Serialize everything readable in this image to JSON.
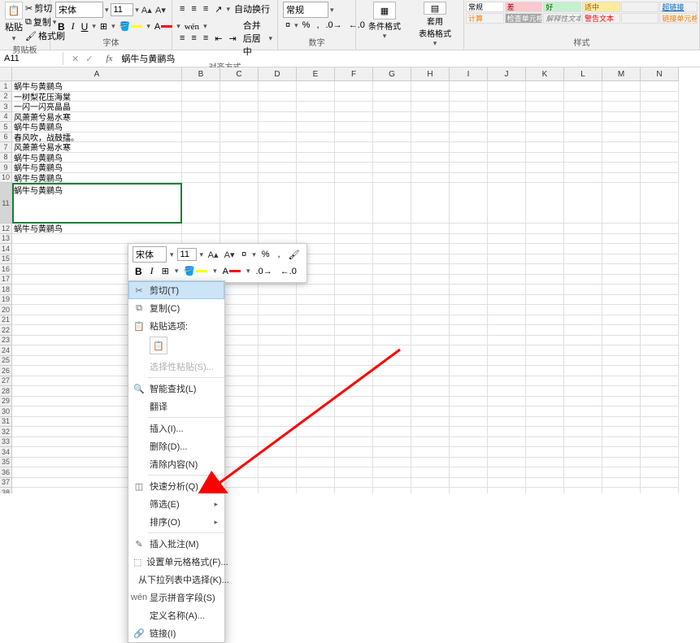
{
  "ribbon": {
    "clipboard": {
      "cut": "剪切",
      "copy": "复制",
      "format_painter": "格式刷",
      "paste": "粘贴",
      "group_label": "剪贴板"
    },
    "font": {
      "name": "宋体",
      "size": "11",
      "group_label": "字体"
    },
    "alignment": {
      "wrap": "自动换行",
      "merge": "合并后居中",
      "group_label": "对齐方式"
    },
    "number": {
      "format": "常规",
      "group_label": "数字"
    },
    "cond": {
      "cond_format": "条件格式",
      "table_format": "套用\n表格格式",
      "group_label": ""
    },
    "styles": {
      "normal": "常规",
      "bad": "差",
      "good": "好",
      "neutral": "适中",
      "hyperlink": "超链接",
      "calc": "计算",
      "check": "检查单元格",
      "explan": "解释性文本",
      "warn": "警告文本",
      "linked": "链接单元格",
      "group_label": "样式"
    }
  },
  "fb": {
    "name_box": "A11",
    "cancel": "✕",
    "confirm": "✓",
    "fx": "fx",
    "formula": "蜗牛与黄鹂鸟"
  },
  "columns": [
    "A",
    "B",
    "C",
    "D",
    "E",
    "F",
    "G",
    "H",
    "I",
    "J",
    "K",
    "L",
    "M",
    "N"
  ],
  "rows_data": [
    "蜗牛与黄鹂鸟",
    "一树梨花压海棠",
    "一闪一闪亮晶晶",
    "风萧萧兮易水寒",
    "蜗牛与黄鹂鸟",
    "春风吹，战鼓擂。",
    "风萧萧兮易水寒",
    "蜗牛与黄鹂鸟",
    "蜗牛与黄鹂鸟",
    "蜗牛与黄鹂鸟",
    "蜗牛与黄鹂鸟"
  ],
  "row_12_text": "蜗牛与黄鹂鸟",
  "mini": {
    "font": "宋体",
    "size": "11"
  },
  "ctxt": {
    "cut": "剪切(T)",
    "copy": "复制(C)",
    "paste_options": "粘贴选项:",
    "paste_special": "选择性粘贴(S)...",
    "smart_lookup": "智能查找(L)",
    "translate": "翻译",
    "insert": "插入(I)...",
    "delete": "删除(D)...",
    "clear": "清除内容(N)",
    "quick": "快速分析(Q)",
    "filter": "筛选(E)",
    "sort": "排序(O)",
    "comment": "插入批注(M)",
    "format_cells": "设置单元格格式(F)...",
    "pick_list": "从下拉列表中选择(K)...",
    "phonetic": "显示拼音字段(S)",
    "define_name": "定义名称(A)...",
    "link": "链接(I)"
  }
}
